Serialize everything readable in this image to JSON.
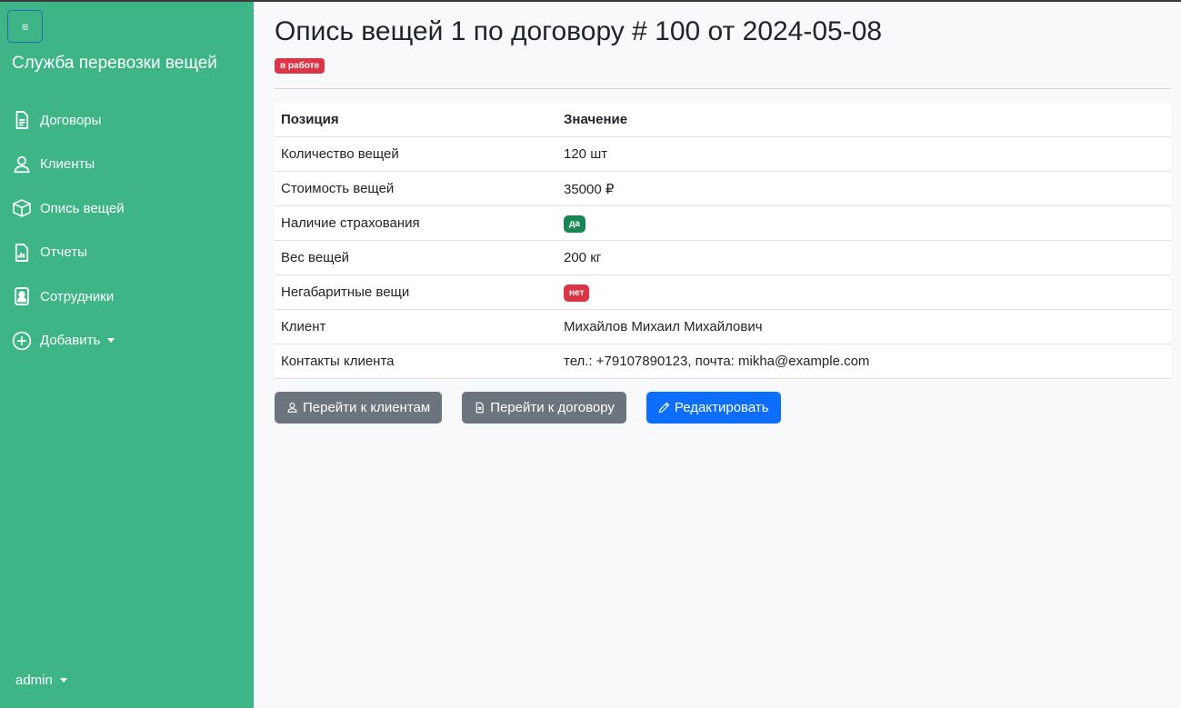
{
  "app": {
    "brand": "Служба перевозки вещей",
    "toggle_glyph": "≡"
  },
  "nav": [
    {
      "label": "Договоры",
      "icon": "document-icon"
    },
    {
      "label": "Клиенты",
      "icon": "person-icon"
    },
    {
      "label": "Опись вещей",
      "icon": "box-icon"
    },
    {
      "label": "Отчеты",
      "icon": "report-icon"
    },
    {
      "label": "Сотрудники",
      "icon": "badge-icon"
    },
    {
      "label": "Добавить",
      "icon": "plus-circle-icon"
    }
  ],
  "user": {
    "name": "admin"
  },
  "page": {
    "title": "Опись вещей 1 по договору # 100 от 2024-05-08",
    "status": "в работе"
  },
  "table": {
    "headers": [
      "Позиция",
      "Значение"
    ],
    "rows": [
      {
        "label": "Количество вещей",
        "value": "120 шт"
      },
      {
        "label": "Стоимость вещей",
        "value": "35000 ₽"
      },
      {
        "label": "Наличие страхования",
        "value": "да",
        "badge_color": "#198754"
      },
      {
        "label": "Вес вещей",
        "value": "200 кг"
      },
      {
        "label": "Негабаритные вещи",
        "value": "нет",
        "badge_color": "#dc3545"
      },
      {
        "label": "Клиент",
        "value": "Михайлов Михаил Михайлович"
      },
      {
        "label": "Контакты клиента",
        "value": "тел.: +79107890123, почта: mikha@example.com"
      }
    ]
  },
  "actions": {
    "to_clients": "Перейти к клиентам",
    "to_contract": "Перейти к договору",
    "edit": "Редактировать"
  },
  "colors": {
    "sidebar": "#3db586",
    "danger": "#dc3545",
    "success": "#198754",
    "primary": "#0d6efd",
    "secondary": "#6c757d"
  }
}
